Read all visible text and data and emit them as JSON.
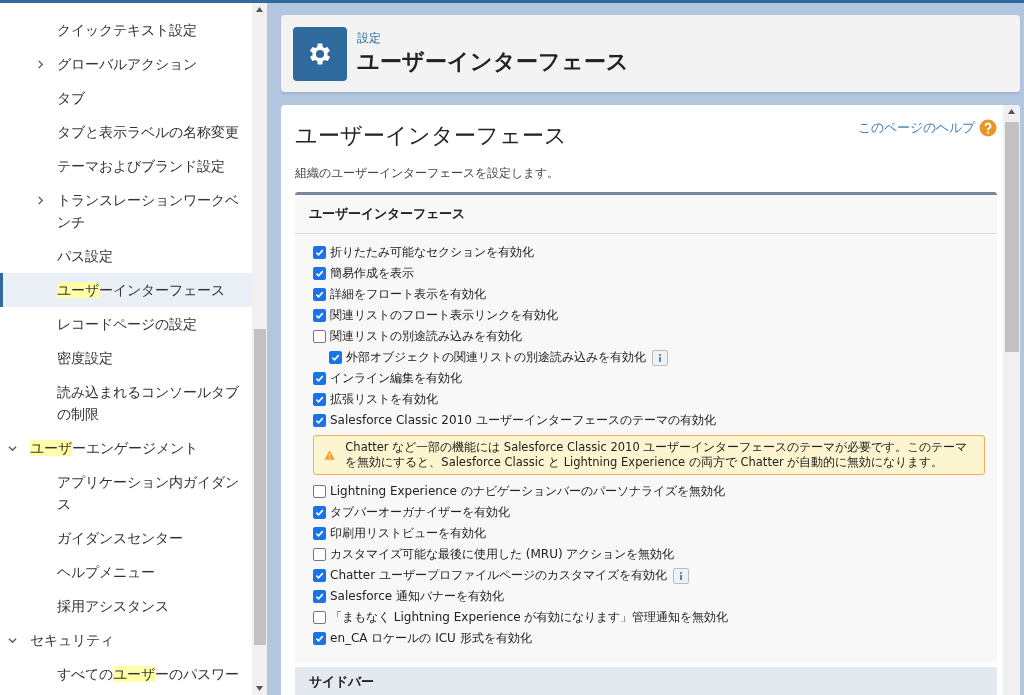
{
  "sidebar": {
    "items": [
      {
        "label": "クイックテキスト設定",
        "selected": false
      },
      {
        "label": "グローバルアクション",
        "expanded": false,
        "selected": false
      },
      {
        "label": "タブ",
        "selected": false
      },
      {
        "label": "タブと表示ラベルの名称変更",
        "selected": false
      },
      {
        "label": "テーマおよびブランド設定",
        "selected": false
      },
      {
        "label": "トランスレーションワークベンチ",
        "expanded": false,
        "selected": false
      },
      {
        "label": "パス設定",
        "selected": false
      },
      {
        "highlight": "ユーザ",
        "after": "ーインターフェース",
        "selected": true
      },
      {
        "label": "レコードページの設定",
        "selected": false
      },
      {
        "label": "密度設定",
        "selected": false
      },
      {
        "label": "読み込まれるコンソールタブの制限",
        "selected": false
      }
    ],
    "groups": [
      {
        "highlight": "ユーザ",
        "after": "ーエンゲージメント",
        "expanded": true,
        "children": [
          {
            "label": "アプリケーション内ガイダンス",
            "selected": false
          },
          {
            "label": "ガイダンスセンター",
            "selected": false
          },
          {
            "label": "ヘルプメニュー",
            "selected": false
          },
          {
            "label": "採用アシスタンス",
            "selected": false
          }
        ]
      },
      {
        "label": "セキュリティ",
        "expanded": true,
        "children": [
          {
            "before": "すべての",
            "highlight": "ユーザ",
            "after": "ーのパスワー",
            "selected": false
          }
        ]
      }
    ]
  },
  "header": {
    "breadcrumb": "設定",
    "title": "ユーザーインターフェース"
  },
  "content": {
    "title": "ユーザーインターフェース",
    "help_link": "このページのヘルプ",
    "description": "組織のユーザーインターフェースを設定します。",
    "section": {
      "title": "ユーザーインターフェース",
      "options": [
        {
          "kind": "checkbox",
          "label": "折りたたみ可能なセクションを有効化",
          "checked": true
        },
        {
          "kind": "checkbox",
          "label": "簡易作成を表示",
          "checked": true
        },
        {
          "kind": "checkbox",
          "label": "詳細をフロート表示を有効化",
          "checked": true
        },
        {
          "kind": "checkbox",
          "label": "関連リストのフロート表示リンクを有効化",
          "checked": true
        },
        {
          "kind": "checkbox",
          "label": "関連リストの別途読み込みを有効化",
          "checked": false,
          "children": [
            {
              "kind": "checkbox",
              "label": "外部オブジェクトの関連リストの別途読み込みを有効化",
              "checked": true,
              "info": true
            }
          ]
        },
        {
          "kind": "checkbox",
          "label": "インライン編集を有効化",
          "checked": true
        },
        {
          "kind": "checkbox",
          "label": "拡張リストを有効化",
          "checked": true
        },
        {
          "kind": "checkbox",
          "label": "Salesforce Classic 2010 ユーザーインターフェースのテーマの有効化",
          "checked": true
        },
        {
          "kind": "warning",
          "label": "Chatter など一部の機能には Salesforce Classic 2010 ユーザーインターフェースのテーマが必要です。このテーマを無効にすると、Salesforce Classic と Lightning Experience の両方で Chatter が自動的に無効になります。"
        },
        {
          "kind": "checkbox",
          "label": "Lightning Experience のナビゲーションバーのパーソナライズを無効化",
          "checked": false
        },
        {
          "kind": "checkbox",
          "label": "タブバーオーガナイザーを有効化",
          "checked": true
        },
        {
          "kind": "checkbox",
          "label": "印刷用リストビューを有効化",
          "checked": true
        },
        {
          "kind": "checkbox",
          "label": "カスタマイズ可能な最後に使用した (MRU) アクションを無効化",
          "checked": false
        },
        {
          "kind": "checkbox",
          "label": "Chatter ユーザープロファイルページのカスタマイズを有効化",
          "checked": true,
          "info": true
        },
        {
          "kind": "checkbox",
          "label": "Salesforce 通知バナーを有効化",
          "checked": true
        },
        {
          "kind": "checkbox",
          "label": "「まもなく Lightning Experience が有効になります」管理通知を無効化",
          "checked": false
        },
        {
          "kind": "checkbox",
          "label": "en_CA ロケールの ICU 形式を有効化",
          "checked": true
        }
      ]
    },
    "next_section": {
      "title": "サイドバー"
    }
  }
}
